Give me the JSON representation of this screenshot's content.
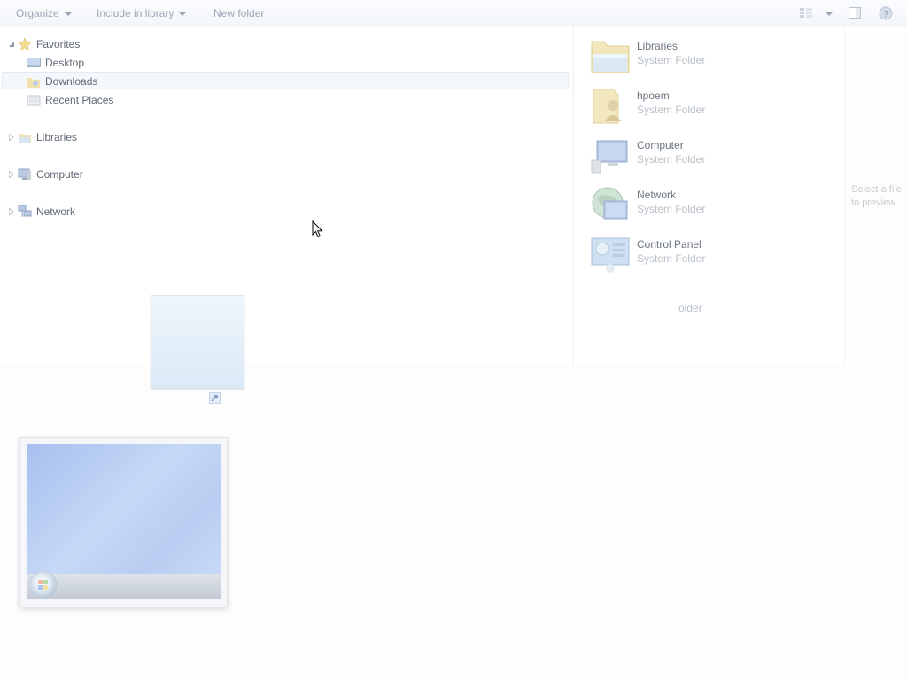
{
  "toolbar": {
    "organize": "Organize",
    "include_in_library": "Include in library",
    "new_folder": "New folder"
  },
  "nav": {
    "favorites": "Favorites",
    "desktop": "Desktop",
    "downloads": "Downloads",
    "recent_places": "Recent Places",
    "libraries": "Libraries",
    "computer": "Computer",
    "network": "Network"
  },
  "content": {
    "items": [
      {
        "name": "Libraries",
        "type": "System Folder",
        "icon": "libraries-icon"
      },
      {
        "name": "hpoem",
        "type": "System Folder",
        "icon": "user-folder-icon"
      },
      {
        "name": "Computer",
        "type": "System Folder",
        "icon": "computer-icon"
      },
      {
        "name": "Network",
        "type": "System Folder",
        "icon": "network-icon"
      },
      {
        "name": "Control Panel",
        "type": "System Folder",
        "icon": "control-panel-icon"
      },
      {
        "name": "",
        "type": "older",
        "icon": ""
      }
    ]
  },
  "preview": {
    "line1": "Select a file",
    "line2": "to preview."
  },
  "colors": {
    "selection_bg": "#f3f8fc",
    "secondary_text": "#b9c0c8",
    "toolbar_text": "#9aa7b6"
  }
}
